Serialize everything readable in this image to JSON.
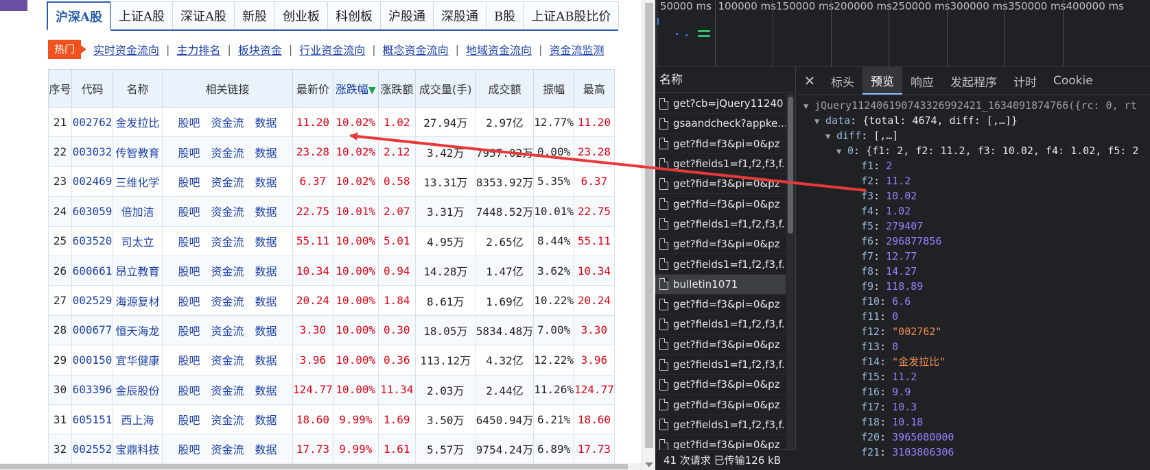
{
  "web": {
    "tabs": [
      "沪深A股",
      "上证A股",
      "深证A股",
      "新股",
      "创业板",
      "科创板",
      "沪股通",
      "深股通",
      "B股",
      "上证AB股比价"
    ],
    "active_tab": 0,
    "hot_label": "热门",
    "hot_links": [
      "实时资金流向",
      "主力排名",
      "板块资金",
      "行业资金流向",
      "概念资金流向",
      "地域资金流向",
      "资金流监测"
    ],
    "table": {
      "headers": [
        "序号",
        "代码",
        "名称",
        "相关链接",
        "最新价",
        "涨跌幅",
        "涨跌额",
        "成交量(手)",
        "成交额",
        "振幅",
        "最高"
      ],
      "link_labels": [
        "股吧",
        "资金流",
        "数据"
      ],
      "rows": [
        [
          "21",
          "002762",
          "金发拉比",
          "11.20",
          "10.02%",
          "1.02",
          "27.94万",
          "2.97亿",
          "12.77%",
          "11.20"
        ],
        [
          "22",
          "003032",
          "传智教育",
          "23.28",
          "10.02%",
          "2.12",
          "3.42万",
          "7957.02万",
          "0.00%",
          "23.28"
        ],
        [
          "23",
          "002469",
          "三维化学",
          "6.37",
          "10.02%",
          "0.58",
          "13.31万",
          "8353.92万",
          "5.35%",
          "6.37"
        ],
        [
          "24",
          "603059",
          "倍加洁",
          "22.75",
          "10.01%",
          "2.07",
          "3.31万",
          "7448.52万",
          "10.01%",
          "22.75"
        ],
        [
          "25",
          "603520",
          "司太立",
          "55.11",
          "10.00%",
          "5.01",
          "4.95万",
          "2.65亿",
          "8.44%",
          "55.11"
        ],
        [
          "26",
          "600661",
          "昂立教育",
          "10.34",
          "10.00%",
          "0.94",
          "14.28万",
          "1.47亿",
          "3.62%",
          "10.34"
        ],
        [
          "27",
          "002529",
          "海源复材",
          "20.24",
          "10.00%",
          "1.84",
          "8.61万",
          "1.69亿",
          "10.22%",
          "20.24"
        ],
        [
          "28",
          "000677",
          "恒天海龙",
          "3.30",
          "10.00%",
          "0.30",
          "18.05万",
          "5834.48万",
          "7.00%",
          "3.30"
        ],
        [
          "29",
          "000150",
          "宜华健康",
          "3.96",
          "10.00%",
          "0.36",
          "113.12万",
          "4.32亿",
          "12.22%",
          "3.96"
        ],
        [
          "30",
          "603396",
          "金辰股份",
          "124.77",
          "10.00%",
          "11.34",
          "2.03万",
          "2.44亿",
          "11.26%",
          "124.77"
        ],
        [
          "31",
          "605151",
          "西上海",
          "18.60",
          "9.99%",
          "1.69",
          "3.50万",
          "6450.94万",
          "6.21%",
          "18.60"
        ],
        [
          "32",
          "002552",
          "宝鼎科技",
          "17.73",
          "9.99%",
          "1.61",
          "5.57万",
          "9754.24万",
          "6.89%",
          "17.73"
        ]
      ]
    }
  },
  "devtools": {
    "timeline_ticks": [
      "50000 ms",
      "100000 ms",
      "150000 ms",
      "200000 ms",
      "250000 ms",
      "300000 ms",
      "350000 ms",
      "400000 ms"
    ],
    "name_header": "名称",
    "requests": [
      "get?cb=jQuery11240",
      "gsaandcheck?appke...",
      "get?fid=f3&pi=0&pz",
      "get?fields1=f1,f2,f3,f...",
      "get?fid=f3&pi=0&pz",
      "get?fid=f3&pi=0&pz",
      "get?fields1=f1,f2,f3,f...",
      "get?fid=f3&pi=0&pz",
      "get?fields1=f1,f2,f3,f...",
      "bulletin1071",
      "get?fid=f3&pi=0&pz",
      "get?fields1=f1,f2,f3,f...",
      "get?fid=f3&pi=0&pz",
      "get?fields1=f1,f2,f3,f...",
      "get?fid=f3&pi=0&pz",
      "get?fid=f3&pi=0&pz",
      "get?fields1=f1,f2,f3,f...",
      "get?fid=f3&pi=0&pz"
    ],
    "selected_request": 9,
    "status": "41 次请求  已传输126 kB",
    "detail_tabs": [
      "标头",
      "预览",
      "响应",
      "发起程序",
      "计时",
      "Cookie"
    ],
    "active_detail_tab": 1,
    "preview": {
      "root": "jQuery1124061907433269924​21_1634091874766({rc: 0, rt",
      "data_line": "{total: 4674, diff: [,…]}",
      "diff_line": "[,…]",
      "item0_line": "{f1: 2, f2: 11.2, f3: 10.02, f4: 1.02, f5: 2",
      "fields": [
        {
          "k": "f1",
          "v": "2",
          "t": "num"
        },
        {
          "k": "f2",
          "v": "11.2",
          "t": "num"
        },
        {
          "k": "f3",
          "v": "10.02",
          "t": "num"
        },
        {
          "k": "f4",
          "v": "1.02",
          "t": "num"
        },
        {
          "k": "f5",
          "v": "279407",
          "t": "num"
        },
        {
          "k": "f6",
          "v": "296877856",
          "t": "num"
        },
        {
          "k": "f7",
          "v": "12.77",
          "t": "num"
        },
        {
          "k": "f8",
          "v": "14.27",
          "t": "num"
        },
        {
          "k": "f9",
          "v": "118.89",
          "t": "num"
        },
        {
          "k": "f10",
          "v": "6.6",
          "t": "num"
        },
        {
          "k": "f11",
          "v": "0",
          "t": "num"
        },
        {
          "k": "f12",
          "v": "\"002762\"",
          "t": "str"
        },
        {
          "k": "f13",
          "v": "0",
          "t": "num"
        },
        {
          "k": "f14",
          "v": "\"金发拉比\"",
          "t": "str"
        },
        {
          "k": "f15",
          "v": "11.2",
          "t": "num"
        },
        {
          "k": "f16",
          "v": "9.9",
          "t": "num"
        },
        {
          "k": "f17",
          "v": "10.3",
          "t": "num"
        },
        {
          "k": "f18",
          "v": "10.18",
          "t": "num"
        },
        {
          "k": "f20",
          "v": "3965080000",
          "t": "num"
        },
        {
          "k": "f21",
          "v": "3103806306",
          "t": "num"
        }
      ]
    }
  },
  "colors": {
    "accent": "#2a5caa",
    "hot": "#f0521f",
    "up": "#e60012",
    "link": "#1b3fa6",
    "devtools_bg": "#202124",
    "annotation_arrow": "#e8393a"
  }
}
